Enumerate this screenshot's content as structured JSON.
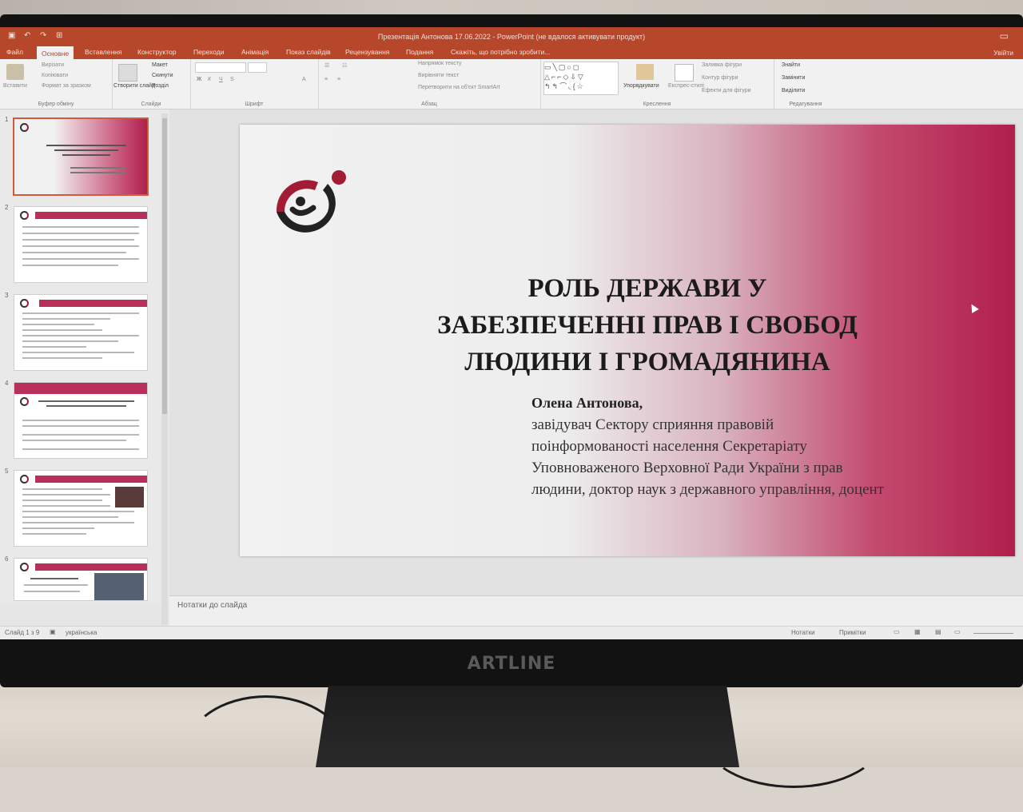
{
  "window": {
    "title": "Презентація Антонова 17.06.2022 - PowerPoint (не вдалося активувати продукт)",
    "signin": "Увійти"
  },
  "tabs": [
    "Файл",
    "Основне",
    "Вставлення",
    "Конструктор",
    "Переходи",
    "Анімація",
    "Показ слайдів",
    "Рецензування",
    "Подання",
    "Скажіть, що потрібно зробити..."
  ],
  "ribbon": {
    "clipboard": {
      "paste": "Вставити",
      "cut": "Вирізати",
      "copy": "Копіювати",
      "format": "Формат за зразком",
      "label": "Буфер обміну"
    },
    "slides": {
      "new": "Створити слайд",
      "layout": "Макет",
      "reset": "Скинути",
      "section": "Розділ",
      "label": "Слайди"
    },
    "font": {
      "label": "Шрифт"
    },
    "paragraph": {
      "direction": "Напрямок тексту",
      "align": "Вирівняти текст",
      "smartart": "Перетворити на об'єкт SmartArt",
      "label": "Абзац"
    },
    "drawing": {
      "arrange": "Упорядкувати",
      "styles": "Експрес-стилі",
      "fill": "Заливка фігури",
      "outline": "Контур фігури",
      "effects": "Ефекти для фігури",
      "label": "Креслення"
    },
    "editing": {
      "find": "Знайти",
      "replace": "Замінити",
      "select": "Виділити",
      "label": "Редагування"
    }
  },
  "thumbnails": [
    {
      "num": "1",
      "selected": true
    },
    {
      "num": "2",
      "selected": false
    },
    {
      "num": "3",
      "selected": false
    },
    {
      "num": "4",
      "selected": false
    },
    {
      "num": "5",
      "selected": false
    },
    {
      "num": "6",
      "selected": false
    }
  ],
  "slide": {
    "title": "РОЛЬ ДЕРЖАВИ У\nЗАБЕЗПЕЧЕННІ ПРАВ І СВОБОД\nЛЮДИНИ І ГРОМАДЯНИНА",
    "author": "Олена Антонова,",
    "affiliation": "завідувач Сектору сприяння правовій\nпоінформованості населення  Секретаріату\nУповноваженого Верховної Ради України з прав\nлюдини, доктор наук з державного управління, доцент"
  },
  "notes_placeholder": "Нотатки до слайда",
  "status": {
    "slide": "Слайд 1 з 9",
    "language": "українська",
    "notes": "Нотатки",
    "comments": "Примітки"
  },
  "monitor_brand": "ARTLINE",
  "colors": {
    "accent": "#b7472a",
    "slide_red": "#b01f4c",
    "logo_red": "#a31c35"
  }
}
